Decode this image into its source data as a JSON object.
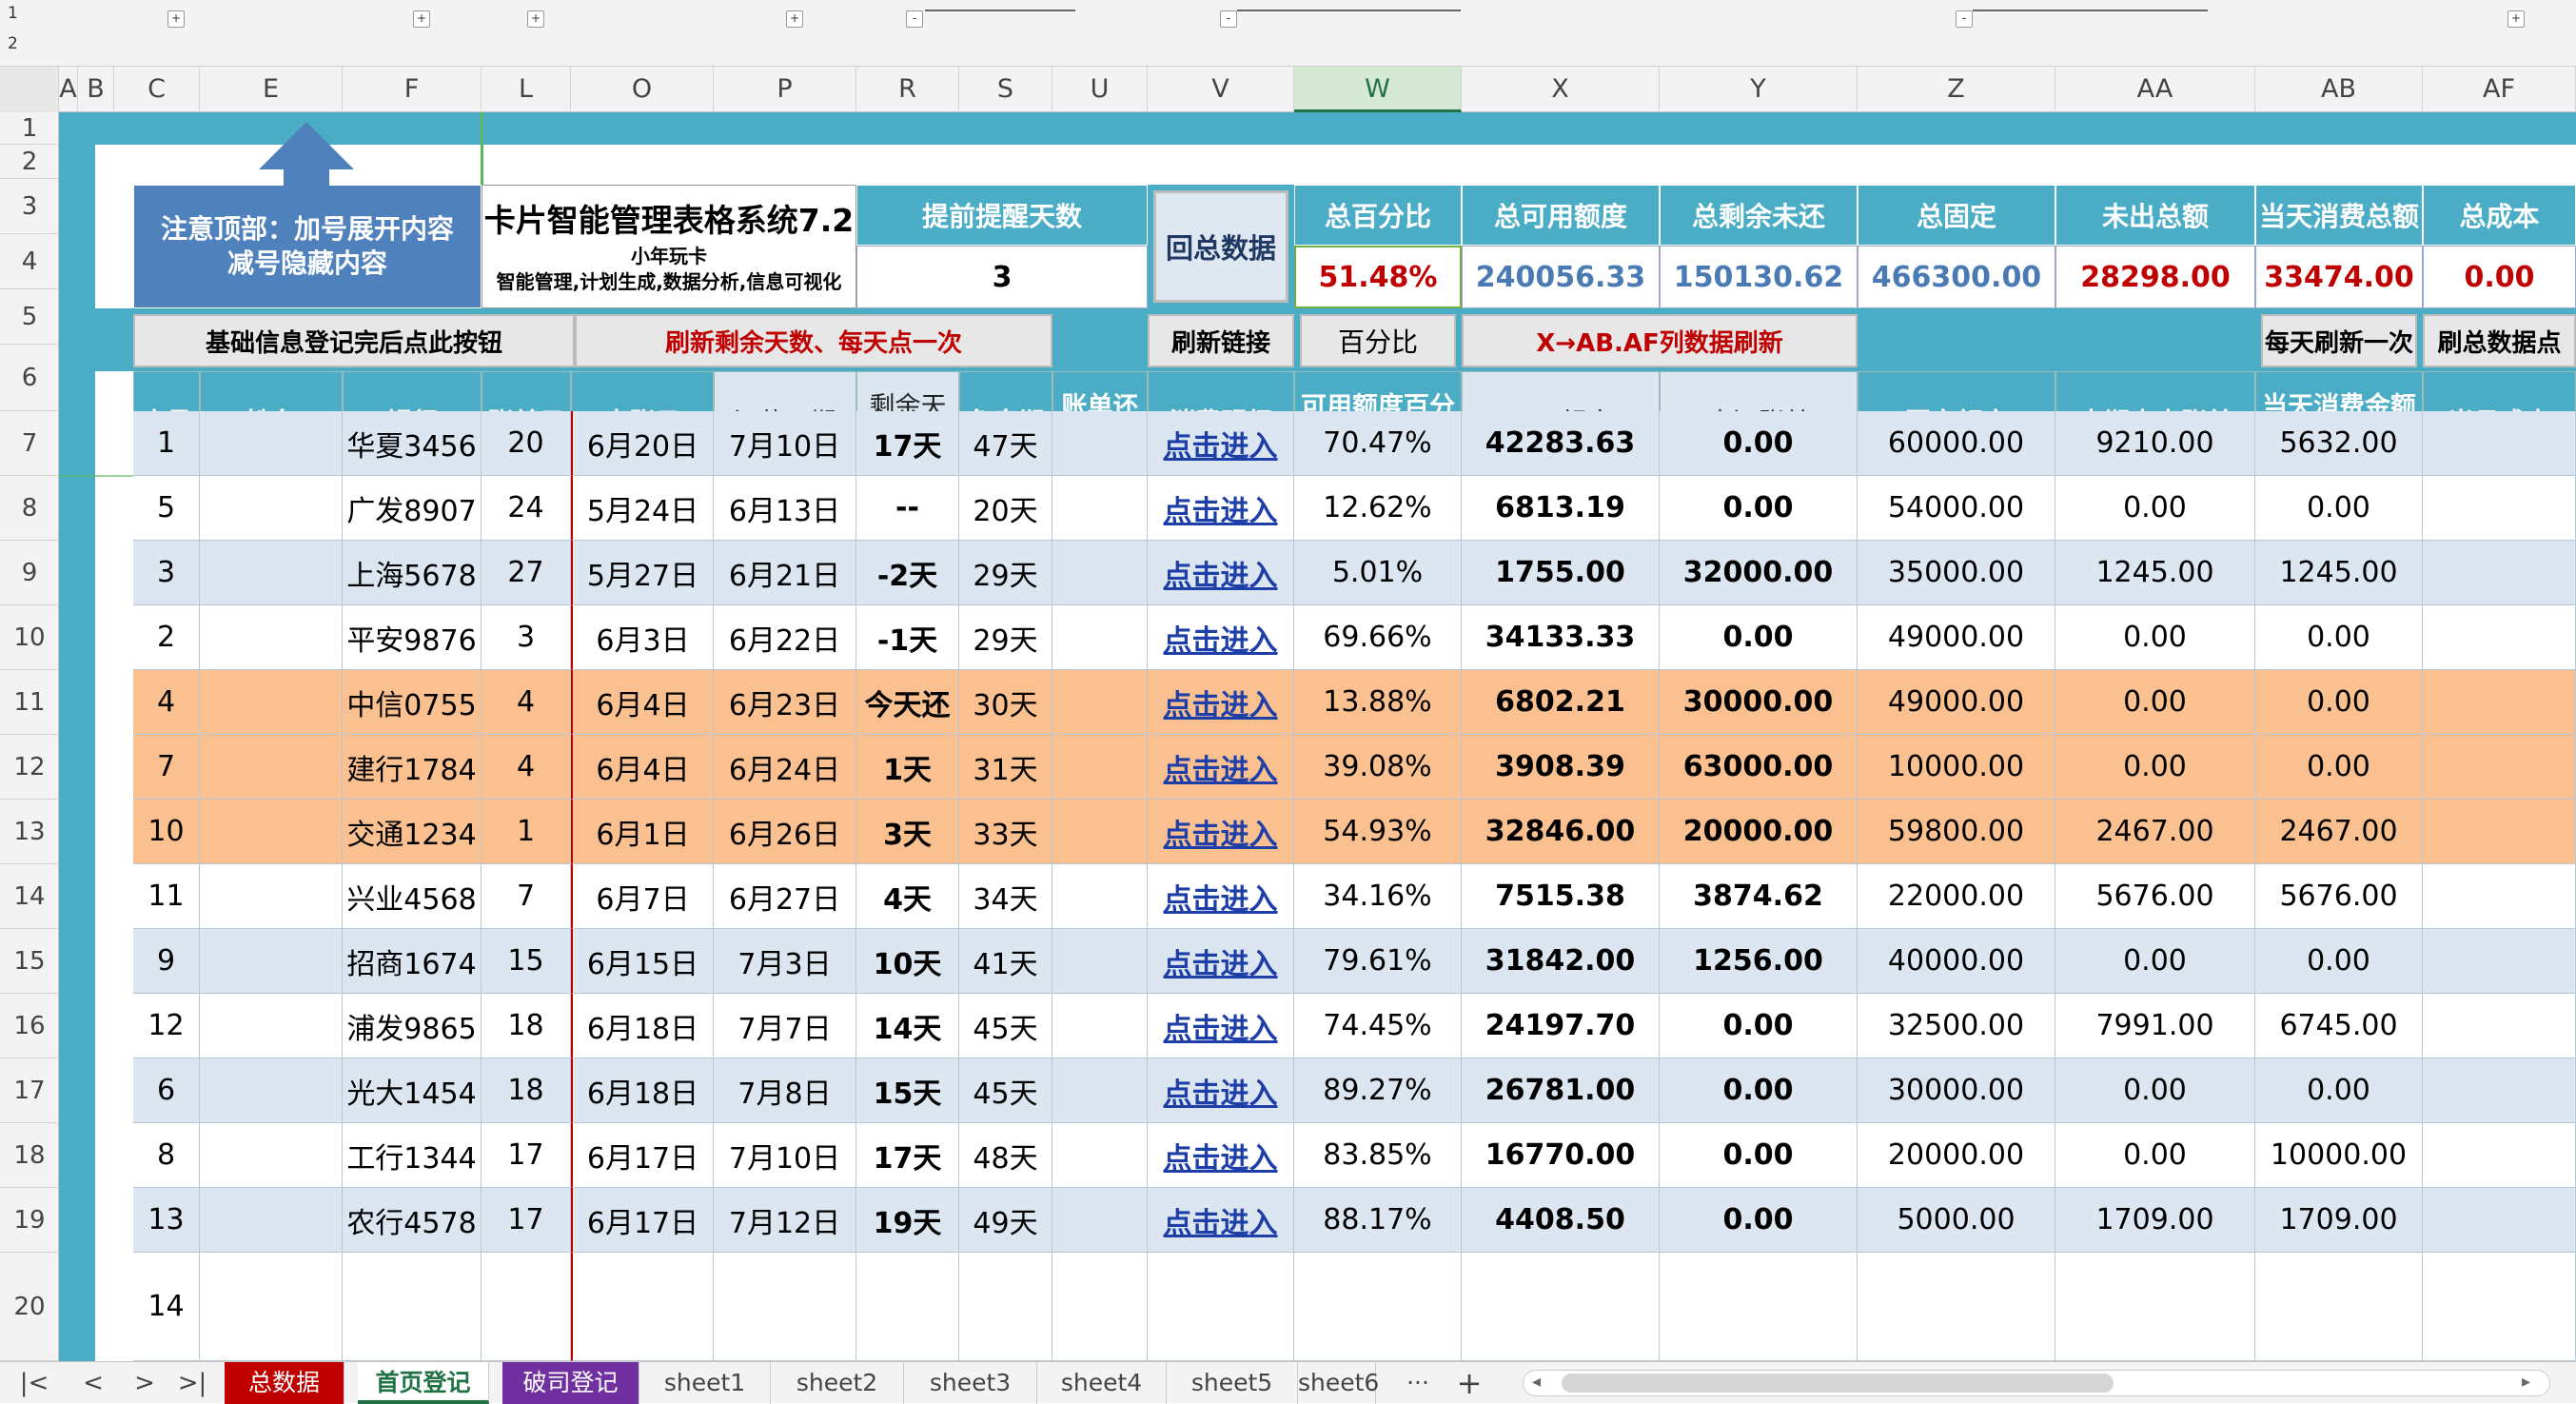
{
  "outline": {
    "levels": [
      "1",
      "2"
    ],
    "buttons": [
      "+",
      "+",
      "+",
      "+",
      "-",
      "-",
      "-",
      "+"
    ]
  },
  "columns": [
    "A",
    "B",
    "C",
    "E",
    "F",
    "L",
    "O",
    "P",
    "R",
    "S",
    "U",
    "V",
    "W",
    "X",
    "Y",
    "Z",
    "AA",
    "AB",
    "AF"
  ],
  "rows": [
    "1",
    "2",
    "3",
    "4",
    "5",
    "6",
    "7",
    "8",
    "9",
    "10",
    "11",
    "12",
    "13",
    "14",
    "15",
    "16",
    "17",
    "18",
    "19",
    "20"
  ],
  "top": {
    "notice_line1": "注意顶部：加号展开内容",
    "notice_line2": "减号隐藏内容",
    "title": "卡片智能管理表格系统7.2",
    "author": "小年玩卡",
    "subtitle": "智能管理,计划生成,数据分析,信息可视化",
    "remind_label": "提前提醒天数",
    "remind_value": "3",
    "summary_button": "回总数据",
    "stats": [
      {
        "label": "总百分比",
        "value": "51.48%",
        "color": "#c00000"
      },
      {
        "label": "总可用额度",
        "value": "240056.33",
        "color": "#4a7ab3"
      },
      {
        "label": "总剩余未还",
        "value": "150130.62",
        "color": "#4a7ab3"
      },
      {
        "label": "总固定",
        "value": "466300.00",
        "color": "#4a7ab3"
      },
      {
        "label": "未出总额",
        "value": "28298.00",
        "color": "#c00000"
      },
      {
        "label": "当天消费总额",
        "value": "33474.00",
        "color": "#c00000"
      },
      {
        "label": "总成本",
        "value": "0.00",
        "color": "#c00000"
      }
    ]
  },
  "buttons": {
    "basic": "基础信息登记完后点此按钮",
    "refresh_days": "刷新剩余天数、每天点一次",
    "refresh_link": "刷新链接",
    "percent": "百分比",
    "refresh_x": "X→AB.AF列数据刷新",
    "daily_refresh": "每天刷新一次",
    "refresh_data": "刷总数据点"
  },
  "headers": [
    "序号",
    "姓名",
    "银行",
    "账单日",
    "出账日",
    "还款日期",
    "剩余天数",
    "免息期",
    "账单还款状态",
    "消费明细",
    "可用额度百分比",
    "可用额度",
    "未还账单",
    "固定额度",
    "本期未出账单",
    "当天消费金额统计",
    "当月成本"
  ],
  "table": [
    {
      "no": "1",
      "name": "",
      "bank": "华夏3456",
      "bill": "20",
      "out": "6月20日",
      "due": "7月10日",
      "left": "17天",
      "free": "47天",
      "status": "",
      "detail": "点击进入",
      "pct": "70.47%",
      "avail": "42283.63",
      "unpaid": "0.00",
      "fixed": "60000.00",
      "unbilled": "9210.00",
      "today": "5632.00",
      "cost": "",
      "hl": false
    },
    {
      "no": "5",
      "name": "",
      "bank": "广发8907",
      "bill": "24",
      "out": "5月24日",
      "due": "6月13日",
      "left": "--",
      "free": "20天",
      "status": "",
      "detail": "点击进入",
      "pct": "12.62%",
      "avail": "6813.19",
      "unpaid": "0.00",
      "fixed": "54000.00",
      "unbilled": "0.00",
      "today": "0.00",
      "cost": "",
      "hl": false
    },
    {
      "no": "3",
      "name": "",
      "bank": "上海5678",
      "bill": "27",
      "out": "5月27日",
      "due": "6月21日",
      "left": "-2天",
      "free": "29天",
      "status": "",
      "detail": "点击进入",
      "pct": "5.01%",
      "avail": "1755.00",
      "unpaid": "32000.00",
      "fixed": "35000.00",
      "unbilled": "1245.00",
      "today": "1245.00",
      "cost": "",
      "hl": false
    },
    {
      "no": "2",
      "name": "",
      "bank": "平安9876",
      "bill": "3",
      "out": "6月3日",
      "due": "6月22日",
      "left": "-1天",
      "free": "29天",
      "status": "",
      "detail": "点击进入",
      "pct": "69.66%",
      "avail": "34133.33",
      "unpaid": "0.00",
      "fixed": "49000.00",
      "unbilled": "0.00",
      "today": "0.00",
      "cost": "",
      "hl": false
    },
    {
      "no": "4",
      "name": "",
      "bank": "中信0755",
      "bill": "4",
      "out": "6月4日",
      "due": "6月23日",
      "left": "今天还",
      "free": "30天",
      "status": "",
      "detail": "点击进入",
      "pct": "13.88%",
      "avail": "6802.21",
      "unpaid": "30000.00",
      "fixed": "49000.00",
      "unbilled": "0.00",
      "today": "0.00",
      "cost": "",
      "hl": true
    },
    {
      "no": "7",
      "name": "",
      "bank": "建行1784",
      "bill": "4",
      "out": "6月4日",
      "due": "6月24日",
      "left": "1天",
      "free": "31天",
      "status": "",
      "detail": "点击进入",
      "pct": "39.08%",
      "avail": "3908.39",
      "unpaid": "63000.00",
      "fixed": "10000.00",
      "unbilled": "0.00",
      "today": "0.00",
      "cost": "",
      "hl": true
    },
    {
      "no": "10",
      "name": "",
      "bank": "交通1234",
      "bill": "1",
      "out": "6月1日",
      "due": "6月26日",
      "left": "3天",
      "free": "33天",
      "status": "",
      "detail": "点击进入",
      "pct": "54.93%",
      "avail": "32846.00",
      "unpaid": "20000.00",
      "fixed": "59800.00",
      "unbilled": "2467.00",
      "today": "2467.00",
      "cost": "",
      "hl": true
    },
    {
      "no": "11",
      "name": "",
      "bank": "兴业4568",
      "bill": "7",
      "out": "6月7日",
      "due": "6月27日",
      "left": "4天",
      "free": "34天",
      "status": "",
      "detail": "点击进入",
      "pct": "34.16%",
      "avail": "7515.38",
      "unpaid": "3874.62",
      "fixed": "22000.00",
      "unbilled": "5676.00",
      "today": "5676.00",
      "cost": "",
      "hl": false
    },
    {
      "no": "9",
      "name": "",
      "bank": "招商1674",
      "bill": "15",
      "out": "6月15日",
      "due": "7月3日",
      "left": "10天",
      "free": "41天",
      "status": "",
      "detail": "点击进入",
      "pct": "79.61%",
      "avail": "31842.00",
      "unpaid": "1256.00",
      "fixed": "40000.00",
      "unbilled": "0.00",
      "today": "0.00",
      "cost": "",
      "hl": false
    },
    {
      "no": "12",
      "name": "",
      "bank": "浦发9865",
      "bill": "18",
      "out": "6月18日",
      "due": "7月7日",
      "left": "14天",
      "free": "45天",
      "status": "",
      "detail": "点击进入",
      "pct": "74.45%",
      "avail": "24197.70",
      "unpaid": "0.00",
      "fixed": "32500.00",
      "unbilled": "7991.00",
      "today": "6745.00",
      "cost": "",
      "hl": false
    },
    {
      "no": "6",
      "name": "",
      "bank": "光大1454",
      "bill": "18",
      "out": "6月18日",
      "due": "7月8日",
      "left": "15天",
      "free": "45天",
      "status": "",
      "detail": "点击进入",
      "pct": "89.27%",
      "avail": "26781.00",
      "unpaid": "0.00",
      "fixed": "30000.00",
      "unbilled": "0.00",
      "today": "0.00",
      "cost": "",
      "hl": false
    },
    {
      "no": "8",
      "name": "",
      "bank": "工行1344",
      "bill": "17",
      "out": "6月17日",
      "due": "7月10日",
      "left": "17天",
      "free": "48天",
      "status": "",
      "detail": "点击进入",
      "pct": "83.85%",
      "avail": "16770.00",
      "unpaid": "0.00",
      "fixed": "20000.00",
      "unbilled": "0.00",
      "today": "10000.00",
      "cost": "",
      "hl": false
    },
    {
      "no": "13",
      "name": "",
      "bank": "农行4578",
      "bill": "17",
      "out": "6月17日",
      "due": "7月12日",
      "left": "19天",
      "free": "49天",
      "status": "",
      "detail": "点击进入",
      "pct": "88.17%",
      "avail": "4408.50",
      "unpaid": "0.00",
      "fixed": "5000.00",
      "unbilled": "1709.00",
      "today": "1709.00",
      "cost": "",
      "hl": false
    },
    {
      "no": "14",
      "name": "",
      "bank": "",
      "bill": "",
      "out": "",
      "due": "",
      "left": "",
      "free": "",
      "status": "",
      "detail": "",
      "pct": "",
      "avail": "",
      "unpaid": "",
      "fixed": "",
      "unbilled": "",
      "today": "",
      "cost": "",
      "hl": false
    }
  ],
  "tabs": [
    {
      "label": "总数据",
      "bg": "#c00000",
      "fg": "#ffffff"
    },
    {
      "label": "首页登记",
      "bg": "#ffffff",
      "fg": "#217346"
    },
    {
      "label": "破司登记",
      "bg": "#7030a0",
      "fg": "#ffffff"
    },
    {
      "label": "sheet1",
      "bg": "",
      "fg": ""
    },
    {
      "label": "sheet2",
      "bg": "",
      "fg": ""
    },
    {
      "label": "sheet3",
      "bg": "",
      "fg": ""
    },
    {
      "label": "sheet4",
      "bg": "",
      "fg": ""
    },
    {
      "label": "sheet5",
      "bg": "",
      "fg": ""
    },
    {
      "label": "sheet6",
      "bg": "",
      "fg": ""
    }
  ],
  "tab_nav": {
    "first": "|<",
    "prev": "<",
    "next": ">",
    "last": ">|",
    "more": "···",
    "add": "+"
  },
  "colors": {
    "accent": "#4bacc6",
    "orange_row": "#fac090",
    "blue_row": "#dce6f1",
    "excel_green": "#217346"
  }
}
